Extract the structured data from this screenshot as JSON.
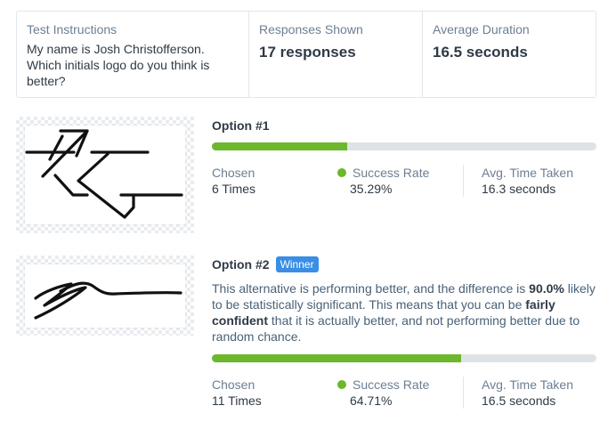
{
  "summary": {
    "instructions_label": "Test Instructions",
    "instructions_text": "My name is Josh Christofferson. Which initials logo do you think is better?",
    "responses_label": "Responses Shown",
    "responses_value": "17 responses",
    "duration_label": "Average Duration",
    "duration_value": "16.5 seconds"
  },
  "options": [
    {
      "title": "Option #1",
      "progress_percent": 35.29,
      "chosen_label": "Chosen",
      "chosen_value": "6 Times",
      "success_label": "Success Rate",
      "success_value": "35.29%",
      "time_label": "Avg. Time Taken",
      "time_value": "16.3 seconds"
    },
    {
      "title": "Option #2",
      "badge": "Winner",
      "desc_1": "This alternative is performing better, and the difference is ",
      "desc_2": "90.0%",
      "desc_3": " likely to be statistically significant. This means that you can be ",
      "desc_4": "fairly confident",
      "desc_5": " that it is actually better, and not performing better due to random chance.",
      "progress_percent": 64.71,
      "chosen_label": "Chosen",
      "chosen_value": "11 Times",
      "success_label": "Success Rate",
      "success_value": "64.71%",
      "time_label": "Avg. Time Taken",
      "time_value": "16.5 seconds"
    }
  ],
  "colors": {
    "success_green": "#6cb72c",
    "winner_blue": "#3a8ee6",
    "bar_track": "#dfe3e8"
  }
}
